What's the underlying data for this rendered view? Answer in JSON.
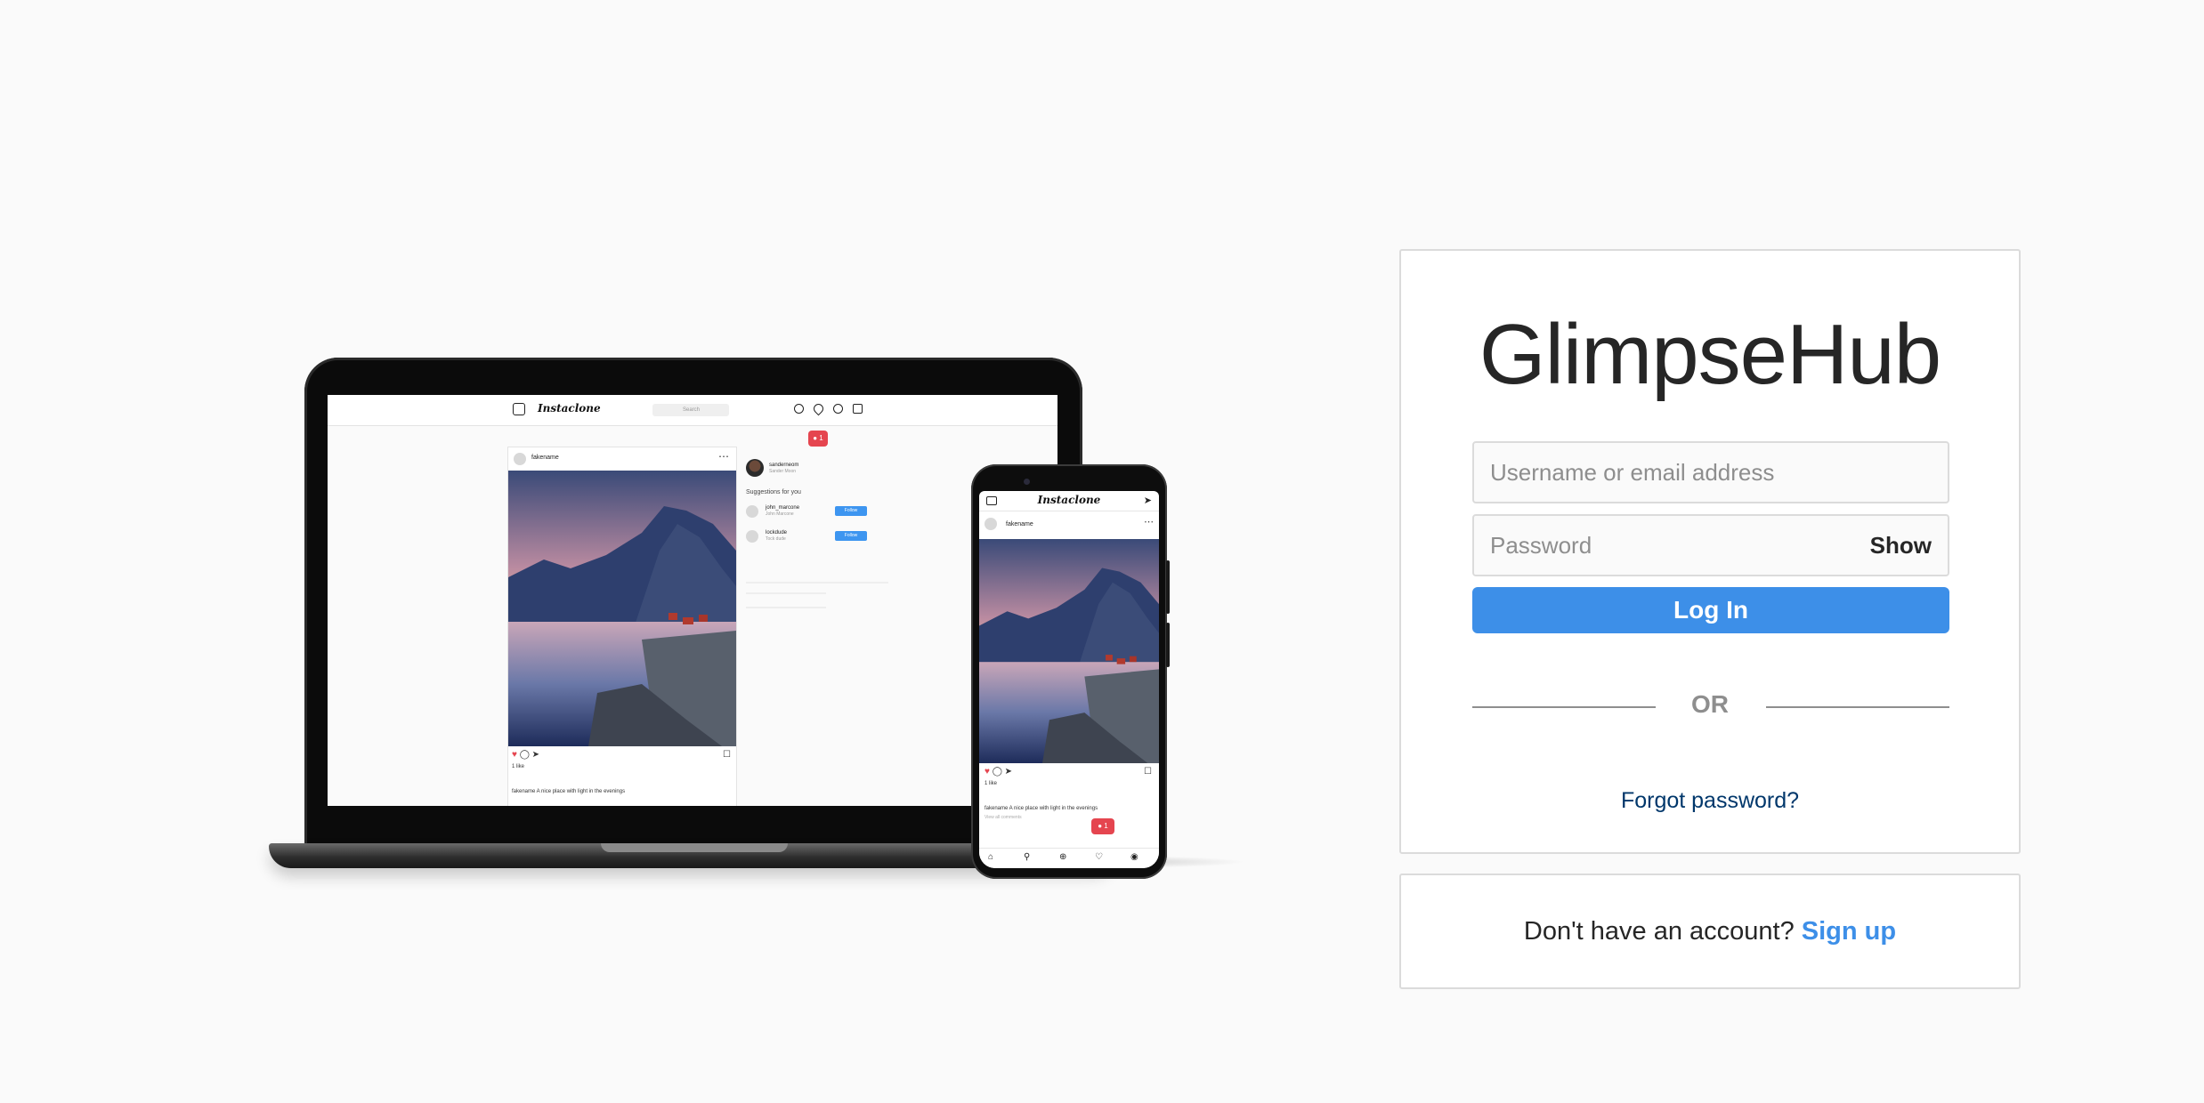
{
  "brand": {
    "name": "GlimpseHub"
  },
  "login": {
    "username_placeholder": "Username or email address",
    "password_placeholder": "Password",
    "show_label": "Show",
    "login_label": "Log In",
    "divider_text": "OR",
    "forgot_label": "Forgot password?"
  },
  "signup": {
    "prompt": "Don't have an account?",
    "link_label": "Sign up"
  },
  "colors": {
    "background": "#fafafa",
    "primary": "#3d8fe8",
    "link_dark": "#00376b",
    "notification": "#e5454f"
  },
  "mockup": {
    "app_name": "Instaclone",
    "search_placeholder": "Search",
    "post_user": "fakename",
    "like_count": "1 like",
    "laptop_caption": "fakename A nice place with light in the evenings",
    "phone_caption": "fakename A nice place with light in the evenings",
    "view_comments": "View all comments",
    "notification_count": "1",
    "profile_name": "sanderneom",
    "profile_sub": "Sander Moon",
    "suggestions_title": "Suggestions for you",
    "suggestions": [
      {
        "name": "john_marcone",
        "sub": "John Marcone",
        "button": "Follow"
      },
      {
        "name": "lockdude",
        "sub": "Tock dude",
        "button": "Follow"
      }
    ],
    "icons": [
      "camera-icon",
      "compass-icon",
      "heart-icon",
      "profile-icon",
      "send-icon",
      "home-icon",
      "search-icon",
      "add-icon"
    ]
  }
}
